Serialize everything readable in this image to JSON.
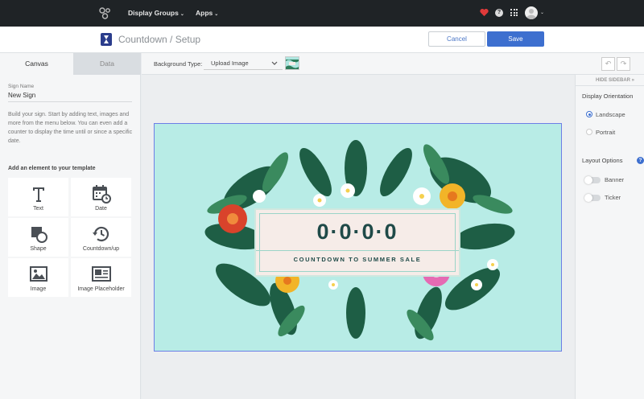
{
  "nav": {
    "display_groups": "Display Groups",
    "apps": "Apps",
    "caret": "⌄",
    "help_glyph": "?"
  },
  "titlebar": {
    "title": "Countdown / Setup",
    "cancel_label": "Cancel",
    "save_label": "Save"
  },
  "left": {
    "tabs": [
      {
        "label": "Canvas",
        "active": true
      },
      {
        "label": "Data",
        "active": false
      }
    ],
    "sign_name_label": "Sign Name",
    "sign_name_value": "New Sign",
    "help_text": "Build your sign. Start by adding text, images and more from the menu below. You can even add a counter to display the time until or since a specific date.",
    "add_label": "Add an element to your template",
    "tiles": [
      {
        "label": "Text",
        "icon": "text-icon"
      },
      {
        "label": "Date",
        "icon": "calendar-clock-icon"
      },
      {
        "label": "Shape",
        "icon": "shape-icon"
      },
      {
        "label": "Countdown/up",
        "icon": "history-clock-icon"
      },
      {
        "label": "Image",
        "icon": "image-icon"
      },
      {
        "label": "Image Placeholder",
        "icon": "image-placeholder-icon"
      }
    ]
  },
  "toolbar": {
    "background_type_label": "Background Type:",
    "background_type_value": "Upload Image",
    "undo_glyph": "↶",
    "redo_glyph": "↷"
  },
  "canvas": {
    "counter": "0·0·0·0",
    "caption": "COUNTDOWN TO SUMMER SALE"
  },
  "right": {
    "hide_sidebar": "HIDE SIDEBAR »",
    "orientation_heading": "Display Orientation",
    "orientations": [
      {
        "label": "Landscape",
        "selected": true
      },
      {
        "label": "Portrait",
        "selected": false
      }
    ],
    "layout_heading": "Layout Options",
    "layout_help_glyph": "?",
    "layout_toggles": [
      {
        "label": "Banner",
        "on": false
      },
      {
        "label": "Ticker",
        "on": false
      }
    ]
  },
  "colors": {
    "nav_bg": "#1f2326",
    "accent": "#3d6fcf",
    "canvas_bg": "#b8ece6",
    "heart": "#e03a3a"
  }
}
